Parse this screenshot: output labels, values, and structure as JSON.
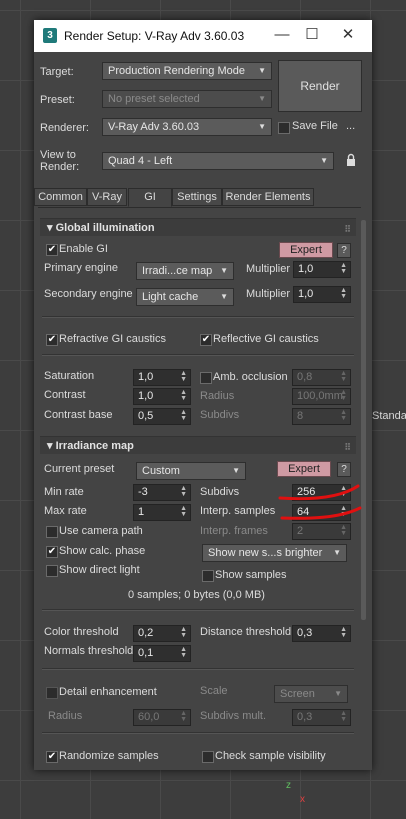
{
  "window": {
    "title": "Render Setup: V-Ray Adv 3.60.03",
    "app_icon": "3ds-max-icon",
    "minimize": "—",
    "maximize": "☐",
    "close": "✕"
  },
  "setup": {
    "target_label": "Target:",
    "target_value": "Production Rendering Mode",
    "preset_label": "Preset:",
    "preset_value": "No preset selected",
    "renderer_label": "Renderer:",
    "renderer_value": "V-Ray Adv 3.60.03",
    "view_label": "View to Render:",
    "view_value": "Quad 4 - Left",
    "render_button": "Render",
    "save_file_label": "Save File",
    "more_button": "..."
  },
  "tabs": [
    {
      "label": "Common"
    },
    {
      "label": "V-Ray"
    },
    {
      "label": "GI"
    },
    {
      "label": "Settings"
    },
    {
      "label": "Render Elements"
    }
  ],
  "gi": {
    "rollout_title": "Global illumination",
    "enable_gi": "Enable GI",
    "expert": "Expert",
    "help": "?",
    "primary_label": "Primary engine",
    "primary_value": "Irradi...ce map",
    "primary_mult_label": "Multiplier",
    "primary_mult": "1,0",
    "secondary_label": "Secondary engine",
    "secondary_value": "Light cache",
    "secondary_mult_label": "Multiplier",
    "secondary_mult": "1,0",
    "refractive": "Refractive GI caustics",
    "reflective": "Reflective GI caustics",
    "saturation_label": "Saturation",
    "saturation": "1,0",
    "contrast_label": "Contrast",
    "contrast": "1,0",
    "contrast_base_label": "Contrast base",
    "contrast_base": "0,5",
    "amb_occlusion_label": "Amb. occlusion",
    "amb_occlusion": "0,8",
    "radius_label": "Radius",
    "radius": "100,0mm",
    "subdivs_label": "Subdivs",
    "subdivs": "8"
  },
  "irradiance": {
    "rollout_title": "Irradiance map",
    "expert": "Expert",
    "help": "?",
    "preset_label": "Current preset",
    "preset_value": "Custom",
    "min_rate_label": "Min rate",
    "min_rate": "-3",
    "max_rate_label": "Max rate",
    "max_rate": "1",
    "subdivs_label": "Subdivs",
    "subdivs": "256",
    "interp_samples_label": "Interp. samples",
    "interp_samples": "64",
    "interp_frames_label": "Interp. frames",
    "interp_frames": "2",
    "use_camera_path": "Use camera path",
    "show_calc_phase": "Show calc. phase",
    "show_direct_light": "Show direct light",
    "show_new_value": "Show new s...s brighter",
    "show_samples": "Show samples",
    "status": "0 samples; 0 bytes (0,0 MB)",
    "color_threshold_label": "Color threshold",
    "color_threshold": "0,2",
    "distance_threshold_label": "Distance threshold",
    "distance_threshold": "0,3",
    "normals_threshold_label": "Normals threshold",
    "normals_threshold": "0,1",
    "detail_enhancement": "Detail enhancement",
    "scale_label": "Scale",
    "scale_value": "Screen",
    "radius_label": "Radius",
    "radius": "60,0",
    "subdivs_mult_label": "Subdivs mult.",
    "subdivs_mult": "0,3",
    "randomize": "Randomize samples",
    "check_visibility": "Check sample visibility"
  },
  "viewport": {
    "label": "Standa",
    "axis_z": "z",
    "axis_x": "x"
  },
  "colors": {
    "expert_button": "#cf9aa3",
    "annotation": "#e01010"
  }
}
